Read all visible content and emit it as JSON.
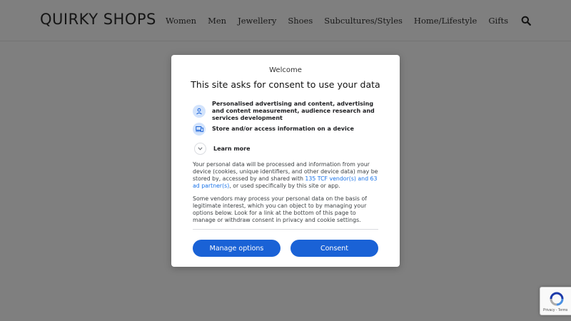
{
  "site": {
    "logo": "QUIRKY SHOPS",
    "nav": [
      "Women",
      "Men",
      "Jewellery",
      "Shoes",
      "Subcultures/Styles",
      "Home/Lifestyle",
      "Gifts"
    ]
  },
  "consent": {
    "welcome": "Welcome",
    "title": "This site asks for consent to use your data",
    "purposes": [
      {
        "icon": "person-icon",
        "text": "Personalised advertising and content, advertising and content measurement, audience research and services development"
      },
      {
        "icon": "device-icon",
        "text": "Store and/or access information on a device"
      }
    ],
    "learn_more": "Learn more",
    "para1_before": "Your personal data will be processed and information from your device (cookies, unique identifiers, and other device data) may be stored by, accessed by and shared with ",
    "para1_link": "135 TCF vendor(s) and 63 ad partner(s)",
    "para1_after": ", or used specifically by this site or app.",
    "para2": "Some vendors may process your personal data on the basis of legitimate interest, which you can object to by managing your options below. Look for a link at the bottom of this page to manage or withdraw consent in privacy and cookie settings.",
    "manage_label": "Manage options",
    "consent_label": "Consent"
  },
  "recaptcha": {
    "links": "Privacy - Terms"
  },
  "colors": {
    "button": "#1a62d6",
    "link": "#1a73e8",
    "icon_bg": "#d2e3fc"
  }
}
